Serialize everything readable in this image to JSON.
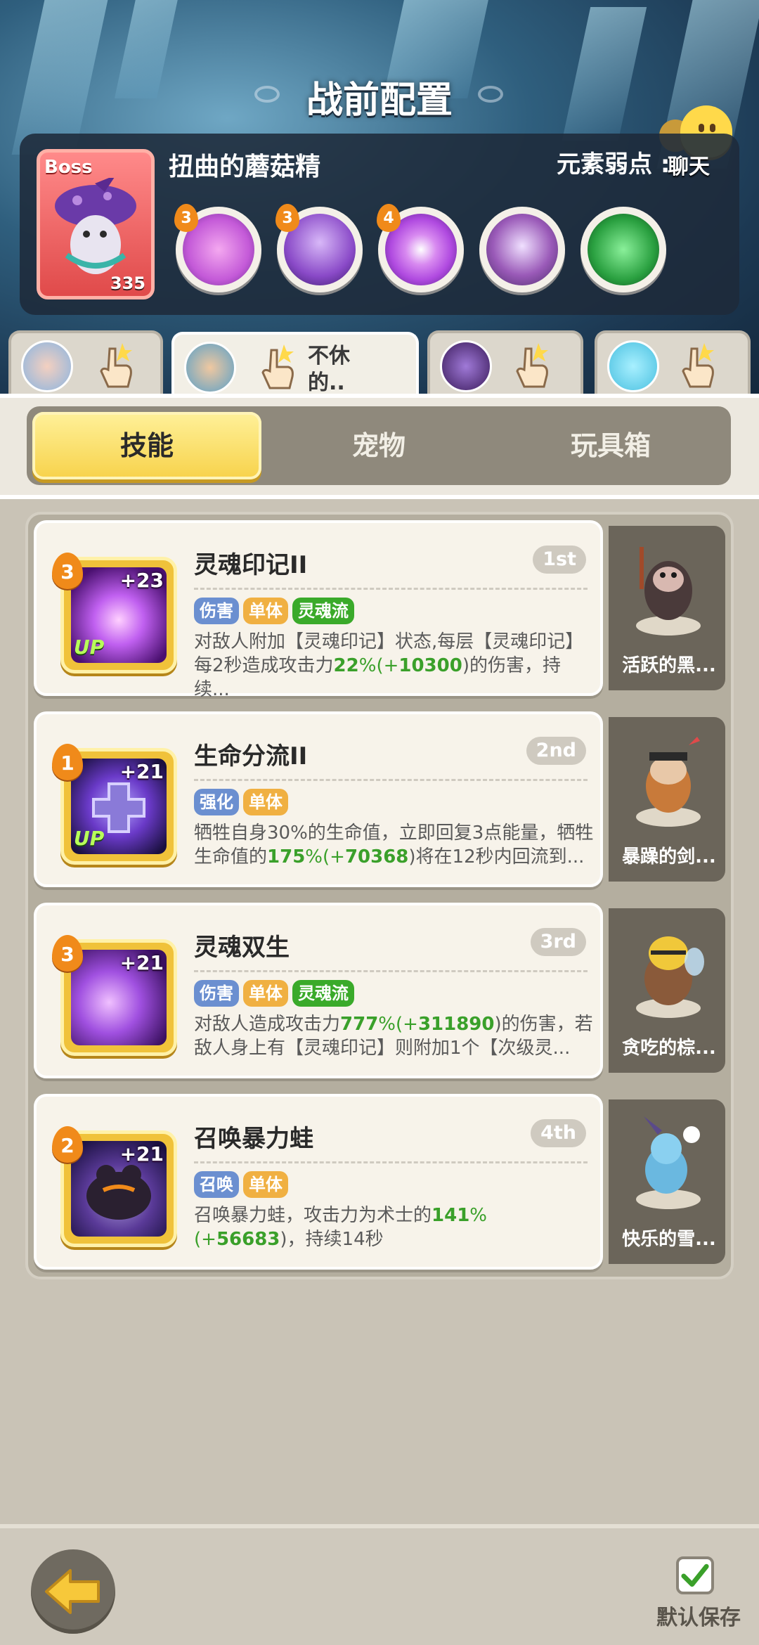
{
  "page": {
    "title": "战前配置",
    "chat_label": "聊天"
  },
  "boss": {
    "tag": "Boss",
    "level": "335",
    "name": "扭曲的蘑菇精",
    "weakness_label": "元素弱点",
    "weakness_separator": ":",
    "skills": [
      {
        "level": "3",
        "icon": "spiral-soul-icon",
        "color": "#c45ad8"
      },
      {
        "level": "3",
        "icon": "ghost-flame-icon",
        "color": "#8a4ac8"
      },
      {
        "level": "4",
        "icon": "mushroom-burst-icon",
        "color": "#b04ae0"
      },
      {
        "level": "",
        "icon": "purple-mushroom-icon",
        "color": "#9a5ab8"
      },
      {
        "level": "",
        "icon": "green-slime-icon",
        "color": "#2aa040"
      }
    ]
  },
  "heroes": [
    {
      "name": "",
      "avatar": "boar-hero-avatar",
      "color": "#8ab4e0"
    },
    {
      "name": "不休的..",
      "avatar": "warrior-hero-avatar",
      "color": "#5aa0c8",
      "active": true
    },
    {
      "name": "",
      "avatar": "shadow-orb-avatar",
      "color": "#5a3a8a"
    },
    {
      "name": "",
      "avatar": "blue-spirit-avatar",
      "color": "#4ac0e0"
    }
  ],
  "tabs": {
    "skills": "技能",
    "pets": "宠物",
    "toybox": "玩具箱",
    "active": "skills"
  },
  "skills": [
    {
      "title": "灵魂印记II",
      "order": "1st",
      "stars": "3",
      "plus": "+23",
      "up": "UP",
      "tags": [
        {
          "label": "伤害",
          "color": "#6b8fd0"
        },
        {
          "label": "单体",
          "color": "#f0b042"
        },
        {
          "label": "灵魂流",
          "color": "#3aaa2a"
        }
      ],
      "desc_1": "对敌人附加【灵魂印记】状态,每层【灵魂印记】每2秒造成攻击力",
      "desc_v1": "22",
      "desc_p1": "%(+",
      "desc_v2": "10300",
      "desc_2": ")的伤害，持续...",
      "pet": "活跃的黑...",
      "icon": "soul-flame-swirl-icon",
      "pet_icon": "black-boar-pet-icon"
    },
    {
      "title": "生命分流II",
      "order": "2nd",
      "stars": "1",
      "plus": "+21",
      "up": "UP",
      "tags": [
        {
          "label": "强化",
          "color": "#6b8fd0"
        },
        {
          "label": "单体",
          "color": "#f0b042"
        }
      ],
      "desc_1": "牺牲自身30%的生命值，立即回复3点能量，牺牲生命值的",
      "desc_v1": "175",
      "desc_p1": "%(+",
      "desc_v2": "70368",
      "desc_2": ")将在12秒内回流到...",
      "pet": "暴躁的剑...",
      "icon": "life-cross-icon",
      "pet_icon": "sword-beaver-pet-icon"
    },
    {
      "title": "灵魂双生",
      "order": "3rd",
      "stars": "3",
      "plus": "+21",
      "up": "",
      "tags": [
        {
          "label": "伤害",
          "color": "#6b8fd0"
        },
        {
          "label": "单体",
          "color": "#f0b042"
        },
        {
          "label": "灵魂流",
          "color": "#3aaa2a"
        }
      ],
      "desc_1": "对敌人造成攻击力",
      "desc_v1": "777",
      "desc_p1": "%(+",
      "desc_v2": "311890",
      "desc_2": ")的伤害，若敌人身上有【灵魂印记】则附加1个【次级灵...",
      "pet": "贪吃的棕...",
      "icon": "twin-soul-flame-icon",
      "pet_icon": "bee-bear-pet-icon"
    },
    {
      "title": "召唤暴力蛙",
      "order": "4th",
      "stars": "2",
      "plus": "+21",
      "up": "",
      "tags": [
        {
          "label": "召唤",
          "color": "#6b8fd0"
        },
        {
          "label": "单体",
          "color": "#f0b042"
        }
      ],
      "desc_1": "召唤暴力蛙，攻击力为术士的",
      "desc_v1": "141",
      "desc_p1": "%(+",
      "desc_v2": "56683",
      "desc_2": ")，持续14秒",
      "pet": "快乐的雪...",
      "icon": "violent-frog-icon",
      "pet_icon": "snow-spirit-pet-icon"
    }
  ],
  "footer": {
    "save_label": "默认保存",
    "save_checked": true
  }
}
